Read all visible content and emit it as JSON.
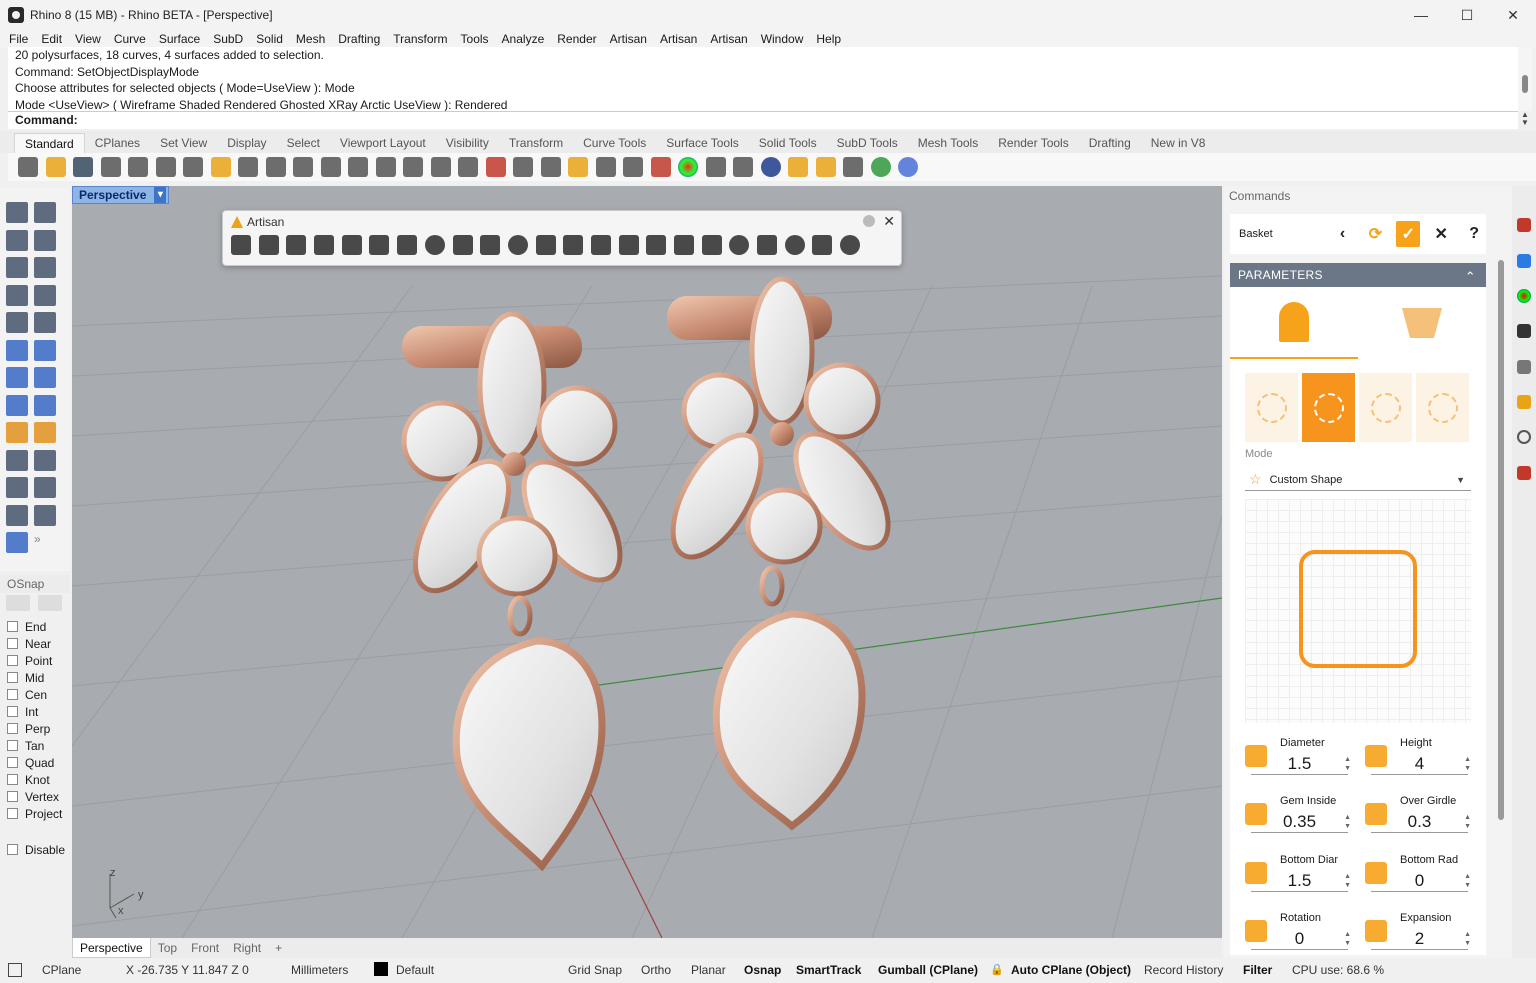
{
  "window": {
    "title": "Rhino 8 (15 MB) - Rhino BETA - [Perspective]",
    "controls": [
      "—",
      "☐",
      "✕"
    ]
  },
  "menu": [
    "File",
    "Edit",
    "View",
    "Curve",
    "Surface",
    "SubD",
    "Solid",
    "Mesh",
    "Drafting",
    "Transform",
    "Tools",
    "Analyze",
    "Render",
    "Artisan",
    "Artisan",
    "Artisan",
    "Window",
    "Help"
  ],
  "history": [
    "20 polysurfaces, 18 curves, 4 surfaces added to selection.",
    "Command: SetObjectDisplayMode",
    "Choose attributes for selected objects ( Mode=UseView ): Mode",
    "Mode <UseView> ( Wireframe  Shaded  Rendered  Ghosted  XRay  Arctic  UseView ): Rendered"
  ],
  "command_prompt": "Command:",
  "toolbar_tabs": [
    "Standard",
    "CPlanes",
    "Set View",
    "Display",
    "Select",
    "Viewport Layout",
    "Visibility",
    "Transform",
    "Curve Tools",
    "Surface Tools",
    "Solid Tools",
    "SubD Tools",
    "Mesh Tools",
    "Render Tools",
    "Drafting",
    "New in V8"
  ],
  "viewport": {
    "active_label": "Perspective",
    "axis_z": "z",
    "axis_y": "y",
    "axis_x": "x"
  },
  "artisan_toolbar": {
    "title": "Artisan"
  },
  "osnap": {
    "title": "OSnap",
    "items": [
      "End",
      "Near",
      "Point",
      "Mid",
      "Cen",
      "Int",
      "Perp",
      "Tan",
      "Quad",
      "Knot",
      "Vertex",
      "Project"
    ],
    "disable": "Disable"
  },
  "view_tabs": [
    "Perspective",
    "Top",
    "Front",
    "Right",
    "+"
  ],
  "commands_panel": {
    "title": "Commands",
    "basket": "Basket",
    "buttons": {
      "back": "‹",
      "refresh": "⟳",
      "ok": "✓",
      "cancel": "✕",
      "help": "?"
    },
    "parameters_header": "PARAMETERS",
    "mode_label": "Mode",
    "mode_value": "Custom Shape",
    "fields": [
      {
        "label": "Diameter",
        "value": "1.5"
      },
      {
        "label": "Height",
        "value": "4"
      },
      {
        "label": "Gem Inside",
        "value": "0.35"
      },
      {
        "label": "Over Girdle",
        "value": "0.3"
      },
      {
        "label": "Bottom Diameter",
        "value": "1.5"
      },
      {
        "label": "Bottom Radius",
        "value": "0"
      },
      {
        "label": "Rotation",
        "value": "0"
      },
      {
        "label": "Expansion",
        "value": "2"
      }
    ]
  },
  "status": {
    "cplane": "CPlane",
    "coords": "X -26.735 Y 11.847 Z 0",
    "units": "Millimeters",
    "layer": "Default",
    "grid_snap": "Grid Snap",
    "ortho": "Ortho",
    "planar": "Planar",
    "osnap": "Osnap",
    "smarttrack": "SmartTrack",
    "gumball": "Gumball (CPlane)",
    "auto_cplane": "Auto CPlane (Object)",
    "record_history": "Record History",
    "filter": "Filter",
    "cpu": "CPU use: 68.6 %"
  },
  "colors": {
    "accent": "#f7a21b",
    "metal": "#c9917a",
    "gem": "#ececec",
    "viewport_bg": "#a8abb0"
  }
}
